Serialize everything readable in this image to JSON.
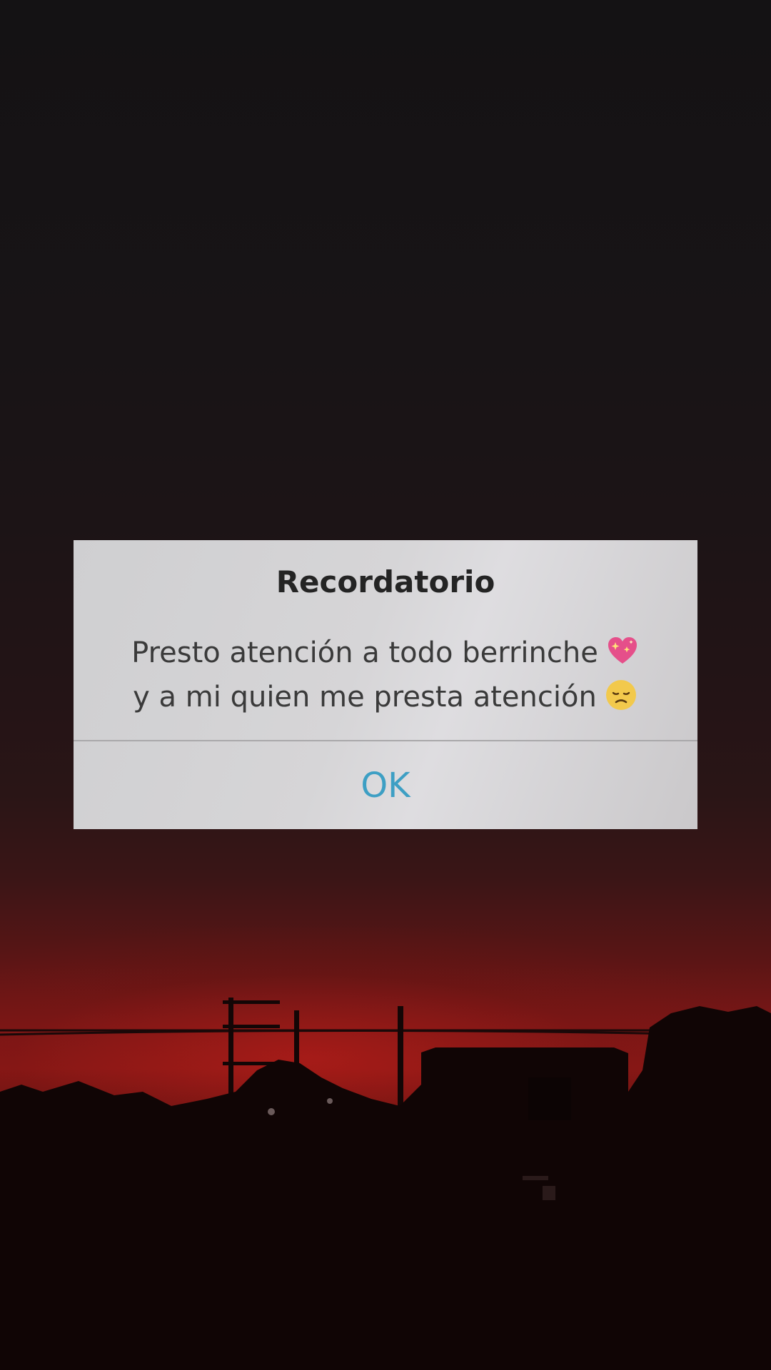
{
  "dialog": {
    "title": "Recordatorio",
    "message_line1": "Presto atención a todo berrinche",
    "message_line1_emoji": "sparkling-heart-icon",
    "message_line2": "y a mi quien me presta atención",
    "message_line2_emoji": "disappointed-face-icon",
    "ok_label": "OK"
  },
  "colors": {
    "ok_button": "#3d9fc4",
    "title_text": "#242424",
    "dialog_background": "#d6d5d7",
    "sky_red": "#8a1816"
  },
  "background": {
    "scene": "sunset-silhouette"
  }
}
